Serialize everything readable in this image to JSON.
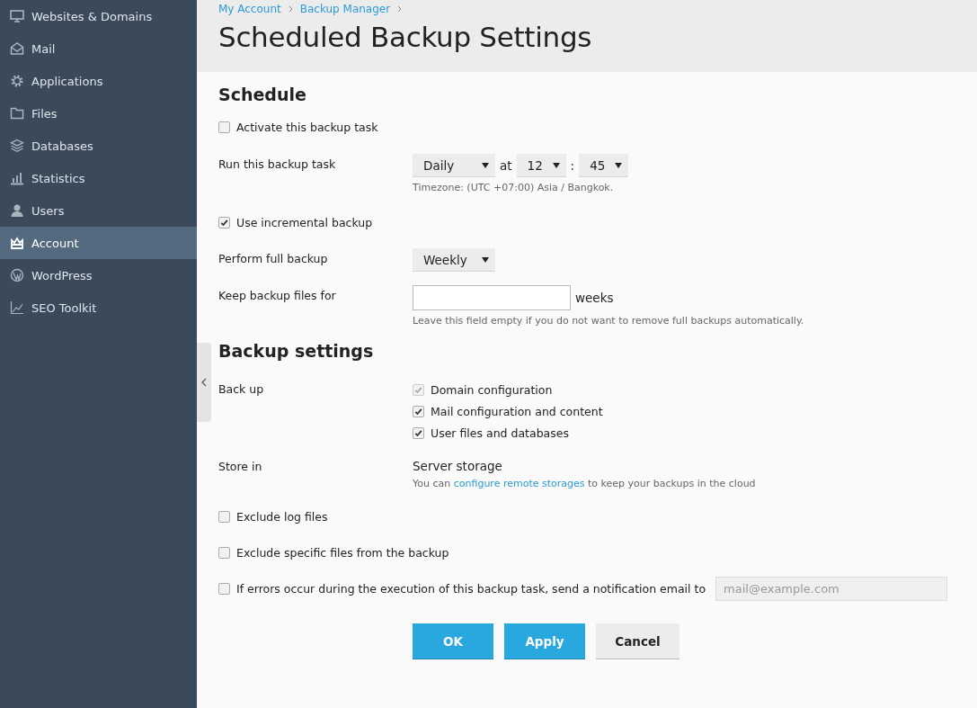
{
  "sidebar": {
    "items": [
      {
        "label": "Websites & Domains",
        "selected": false
      },
      {
        "label": "Mail",
        "selected": false
      },
      {
        "label": "Applications",
        "selected": false
      },
      {
        "label": "Files",
        "selected": false
      },
      {
        "label": "Databases",
        "selected": false
      },
      {
        "label": "Statistics",
        "selected": false
      },
      {
        "label": "Users",
        "selected": false
      },
      {
        "label": "Account",
        "selected": true
      },
      {
        "label": "WordPress",
        "selected": false
      },
      {
        "label": "SEO Toolkit",
        "selected": false
      }
    ]
  },
  "breadcrumbs": [
    "My Account",
    "Backup Manager"
  ],
  "title": "Scheduled Backup Settings",
  "schedule": {
    "heading": "Schedule",
    "activate": {
      "label": "Activate this backup task",
      "checked": false
    },
    "run": {
      "label": "Run this backup task",
      "frequency": "Daily",
      "at": "at",
      "hour": "12",
      "separator": ":",
      "minute": "45",
      "hint": "Timezone: (UTC +07:00) Asia / Bangkok."
    },
    "incremental": {
      "label": "Use incremental backup",
      "checked": true
    },
    "full": {
      "label": "Perform full backup",
      "value": "Weekly"
    },
    "keep": {
      "label": "Keep backup files for",
      "unit": "weeks",
      "hint": "Leave this field empty if you do not want to remove full backups automatically."
    }
  },
  "backup_settings": {
    "heading": "Backup settings",
    "back_up": {
      "label": "Back up",
      "options": [
        {
          "label": "Domain configuration",
          "checked": true,
          "disabled": true
        },
        {
          "label": "Mail configuration and content",
          "checked": true,
          "disabled": false
        },
        {
          "label": "User files and databases",
          "checked": true,
          "disabled": false
        }
      ]
    },
    "store": {
      "label": "Store in",
      "value": "Server storage",
      "note_before": "You can",
      "link": "configure remote storages",
      "note_after": "to keep your backups in the cloud"
    },
    "options": [
      {
        "label": "Exclude log files",
        "checked": false
      },
      {
        "label": "Exclude specific files from the backup",
        "checked": false
      },
      {
        "label": "If errors occur during the execution of this backup task, send a notification email to",
        "checked": false,
        "placeholder": "mail@example.com"
      }
    ]
  },
  "buttons": [
    {
      "label": "OK",
      "kind": "primary"
    },
    {
      "label": "Apply",
      "kind": "primary"
    },
    {
      "label": "Cancel",
      "kind": "secondary"
    }
  ]
}
